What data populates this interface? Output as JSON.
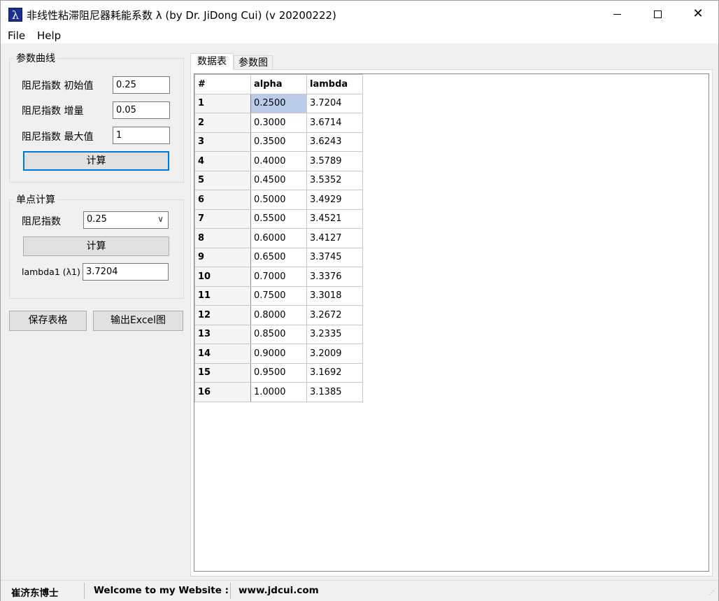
{
  "window": {
    "title": "非线性粘滞阻尼器耗能系数 λ (by Dr. JiDong Cui) (v 20200222)",
    "icon_glyph": "λ"
  },
  "menu": {
    "file": "File",
    "help": "Help"
  },
  "curve_group": {
    "title": "参数曲线",
    "initial_label": "阻尼指数 初始值",
    "initial_value": "0.25",
    "increment_label": "阻尼指数 增量",
    "increment_value": "0.05",
    "max_label": "阻尼指数 最大值",
    "max_value": "1",
    "calc_button": "计算"
  },
  "single_group": {
    "title": "单点计算",
    "exponent_label": "阻尼指数",
    "exponent_value": "0.25",
    "calc_button": "计算",
    "lambda_label": "lambda1 (λ1)",
    "lambda_value": "3.7204"
  },
  "buttons": {
    "save_table": "保存表格",
    "export_excel": "输出Excel图"
  },
  "tabs": {
    "data": "数据表",
    "chart": "参数图"
  },
  "table": {
    "headers": [
      "#",
      "alpha",
      "lambda"
    ],
    "rows": [
      [
        "1",
        "0.2500",
        "3.7204"
      ],
      [
        "2",
        "0.3000",
        "3.6714"
      ],
      [
        "3",
        "0.3500",
        "3.6243"
      ],
      [
        "4",
        "0.4000",
        "3.5789"
      ],
      [
        "5",
        "0.4500",
        "3.5352"
      ],
      [
        "6",
        "0.5000",
        "3.4929"
      ],
      [
        "7",
        "0.5500",
        "3.4521"
      ],
      [
        "8",
        "0.6000",
        "3.4127"
      ],
      [
        "9",
        "0.6500",
        "3.3745"
      ],
      [
        "10",
        "0.7000",
        "3.3376"
      ],
      [
        "11",
        "0.7500",
        "3.3018"
      ],
      [
        "12",
        "0.8000",
        "3.2672"
      ],
      [
        "13",
        "0.8500",
        "3.2335"
      ],
      [
        "14",
        "0.9000",
        "3.2009"
      ],
      [
        "15",
        "0.9500",
        "3.1692"
      ],
      [
        "16",
        "1.0000",
        "3.1385"
      ]
    ]
  },
  "status": {
    "author": "崔济东博士",
    "welcome": "Welcome to my Website :",
    "website": "www.jdcui.com"
  },
  "colors": {
    "accent": "#0078d7",
    "selection": "#b9cdea",
    "icon_bg": "#1a2f8f"
  }
}
